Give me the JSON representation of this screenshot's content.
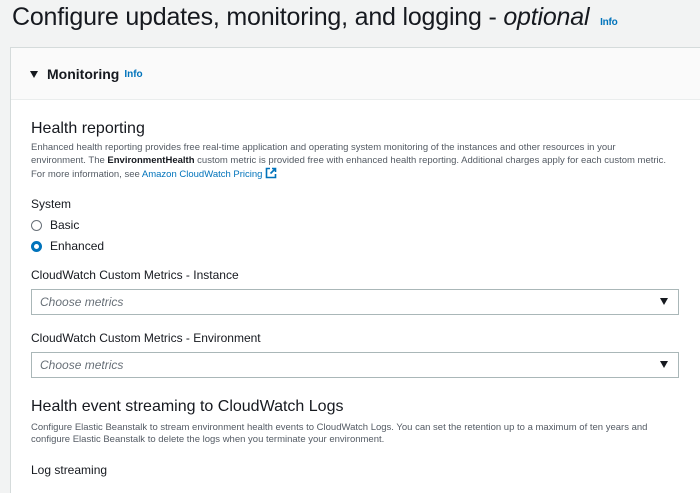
{
  "page": {
    "title_main": "Configure updates, monitoring, and logging - ",
    "title_italic": "optional",
    "info_label": "Info"
  },
  "monitoring": {
    "section_label": "Monitoring",
    "info_label": "Info",
    "health_reporting": {
      "heading": "Health reporting",
      "desc_part1": "Enhanced health reporting provides free real-time application and operating system monitoring of the instances and other resources in your environment. The ",
      "desc_bold": "EnvironmentHealth",
      "desc_part2": " custom metric is provided free with enhanced health reporting. Additional charges apply for each custom metric. For more information, see ",
      "desc_link": "Amazon CloudWatch Pricing"
    },
    "system": {
      "label": "System",
      "options": [
        {
          "label": "Basic",
          "selected": false
        },
        {
          "label": "Enhanced",
          "selected": true
        }
      ]
    },
    "instance_metrics": {
      "label": "CloudWatch Custom Metrics - Instance",
      "placeholder": "Choose metrics"
    },
    "environment_metrics": {
      "label": "CloudWatch Custom Metrics - Environment",
      "placeholder": "Choose metrics"
    },
    "health_streaming": {
      "heading": "Health event streaming to CloudWatch Logs",
      "desc": "Configure Elastic Beanstalk to stream environment health events to CloudWatch Logs. You can set the retention up to a maximum of ten years and configure Elastic Beanstalk to delete the logs when you terminate your environment.",
      "log_streaming_label": "Log streaming"
    }
  },
  "colors": {
    "link": "#0073bb",
    "radio_selected": "#0073bb",
    "page_bg": "#f2f3f3"
  }
}
